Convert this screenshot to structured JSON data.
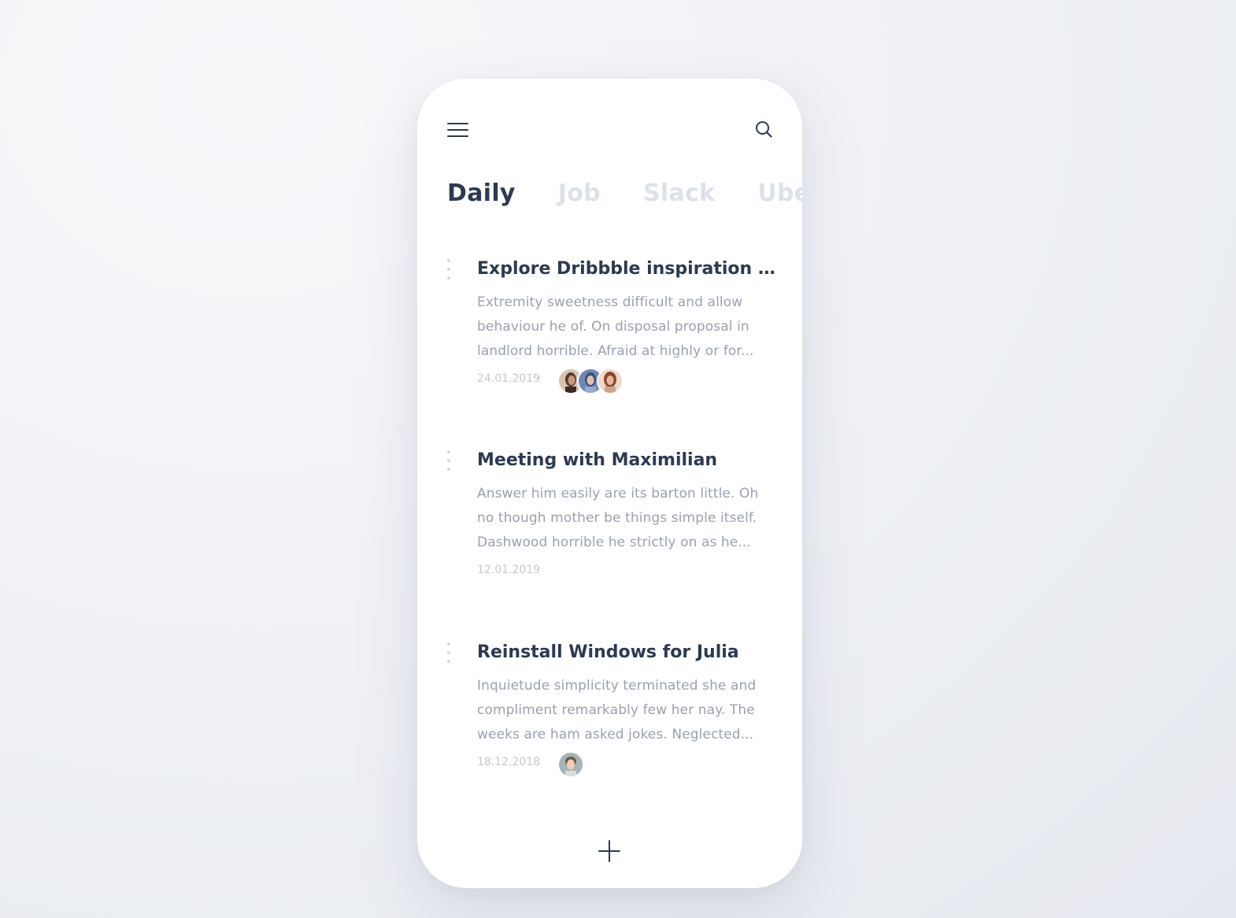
{
  "header": {
    "menu_icon": "hamburger-menu-icon",
    "search_icon": "search-icon"
  },
  "tabs": [
    {
      "label": "Daily",
      "active": true
    },
    {
      "label": "Job",
      "active": false
    },
    {
      "label": "Slack",
      "active": false
    },
    {
      "label": "Uber",
      "active": false
    }
  ],
  "notes": [
    {
      "title": "Explore Dribbble inspiration s...",
      "body_lines": [
        "Extremity sweetness difficult and allow",
        "behaviour he of. On disposal proposal in",
        "landlord horrible. Afraid at highly or for..."
      ],
      "date": "24.01.2019"
    },
    {
      "title": "Meeting with Maximilian",
      "body_lines": [
        "Answer him easily are its barton little. Oh",
        "no though mother be things simple itself.",
        "Dashwood horrible he strictly on as he..."
      ],
      "date": "12.01.2019"
    },
    {
      "title": "Reinstall Windows for Julia",
      "body_lines": [
        "Inquietude simplicity terminated she and",
        "compliment remarkably few her nay. The",
        "weeks are ham asked jokes. Neglected..."
      ],
      "date": "18.12.2018"
    }
  ],
  "footer": {
    "add_icon": "plus-icon"
  },
  "colors": {
    "primary_text": "#2c3a52",
    "secondary_text": "#9aa1ad",
    "muted_text": "#c3c8d0",
    "inactive_tab": "#dde1e8"
  }
}
